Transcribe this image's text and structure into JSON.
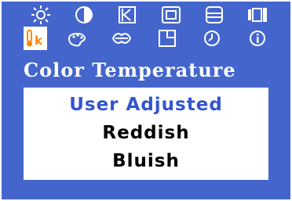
{
  "section_title": "Color Temperature",
  "selected_icon_label": "k",
  "menu": {
    "items": [
      {
        "label": "User Adjusted",
        "selected": true
      },
      {
        "label": "Reddish",
        "selected": false
      },
      {
        "label": "Bluish",
        "selected": false
      }
    ]
  },
  "colors": {
    "background": "#4466cc",
    "icon": "#ffffff",
    "selected_icon": "#ff8800",
    "menu_box": "#ffffff",
    "menu_text": "#000000",
    "menu_text_selected": "#3355cc"
  },
  "icons": {
    "row1": [
      "brightness-icon",
      "contrast-icon",
      "position-icon",
      "size-icon",
      "image-lock-icon",
      "video-icon"
    ],
    "row2": [
      "color-temperature-icon",
      "color-control-icon",
      "language-icon",
      "osd-position-icon",
      "osd-timer-icon",
      "information-icon"
    ]
  }
}
